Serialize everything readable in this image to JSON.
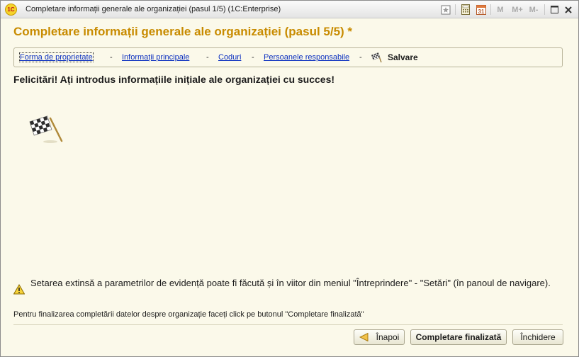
{
  "window": {
    "title": "Completare informații generale ale organizației (pasul 1/5)  (1C:Enterprise)",
    "app_logo_text": "1C",
    "toolbar": {
      "memory_labels": [
        "M",
        "M+",
        "M-"
      ],
      "calendar_day": "31"
    }
  },
  "page": {
    "title": "Completare informații generale ale organizației (pasul 5/5) *",
    "steps": [
      {
        "label": "Forma de proprietate"
      },
      {
        "label": "Informații principale"
      },
      {
        "label": "Coduri"
      },
      {
        "label": "Persoanele responsabile"
      }
    ],
    "step_separator": "-",
    "current_step": "Salvare",
    "congrats_text": "Felicitări! Ați introdus informațiile inițiale ale organizației cu succes!",
    "warning_text": "Setarea extinsă a parametrilor de evidență poate fi făcută și în viitor din meniul \"Întreprindere\" - \"Setări\" (în panoul de navigare).",
    "hint_text": "Pentru finalizarea completării datelor despre organizație faceți click pe butonul \"Completare finalizată\""
  },
  "buttons": {
    "back": "Înapoi",
    "finish": "Completare finalizată",
    "close": "Închidere"
  },
  "icons": {
    "app": "1c-logo-icon",
    "favorite": "favorite-icon",
    "calculator": "calculator-icon",
    "calendar": "calendar-icon",
    "maximize": "maximize-icon",
    "close": "close-icon",
    "finish_flag": "checkered-flag-icon",
    "warning": "warning-icon",
    "back": "back-arrow-icon"
  },
  "colors": {
    "title": "#c88b00",
    "link": "#0b2fbf",
    "background": "#fbf9ea"
  }
}
